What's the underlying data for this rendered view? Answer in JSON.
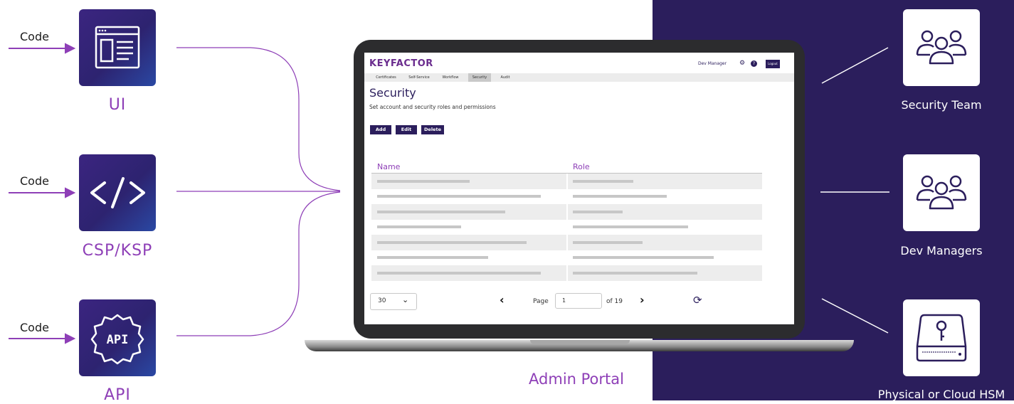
{
  "left": {
    "sources": [
      {
        "code_label": "Code",
        "caption": "UI",
        "icon": "browser-window-icon"
      },
      {
        "code_label": "Code",
        "caption": "CSP/KSP",
        "icon": "code-brackets-icon"
      },
      {
        "code_label": "Code",
        "caption": "API",
        "icon": "api-gear-icon"
      }
    ]
  },
  "portal": {
    "caption": "Admin Portal",
    "logo": "KEYFACTOR",
    "user": "Dev Manager",
    "logout_label": "Logout",
    "help_label": "?",
    "tabs": [
      "Certificates",
      "Self-Service",
      "Workflow",
      "Security",
      "Audit"
    ],
    "active_tab": "Security",
    "title": "Security",
    "subtitle": "Set account and security roles and permissions",
    "buttons": {
      "add": "Add",
      "edit": "Edit",
      "delete": "Delete"
    },
    "table": {
      "columns": [
        "Name",
        "Role"
      ],
      "row_count": 7
    },
    "pagination": {
      "page_size": "30",
      "page_label": "Page",
      "page_value": "1",
      "of_label": "of 19"
    }
  },
  "right": {
    "groups": [
      {
        "caption": "Security Team",
        "icon": "users-group-icon"
      },
      {
        "caption": "Dev Managers",
        "icon": "users-group-icon"
      },
      {
        "caption": "Physical or Cloud HSM",
        "icon": "hsm-key-icon"
      }
    ]
  },
  "colors": {
    "accent": "#8e3fb7",
    "navy": "#2b1e5c",
    "arrow": "#8e3fb7",
    "connector": "#8e3fb7"
  }
}
